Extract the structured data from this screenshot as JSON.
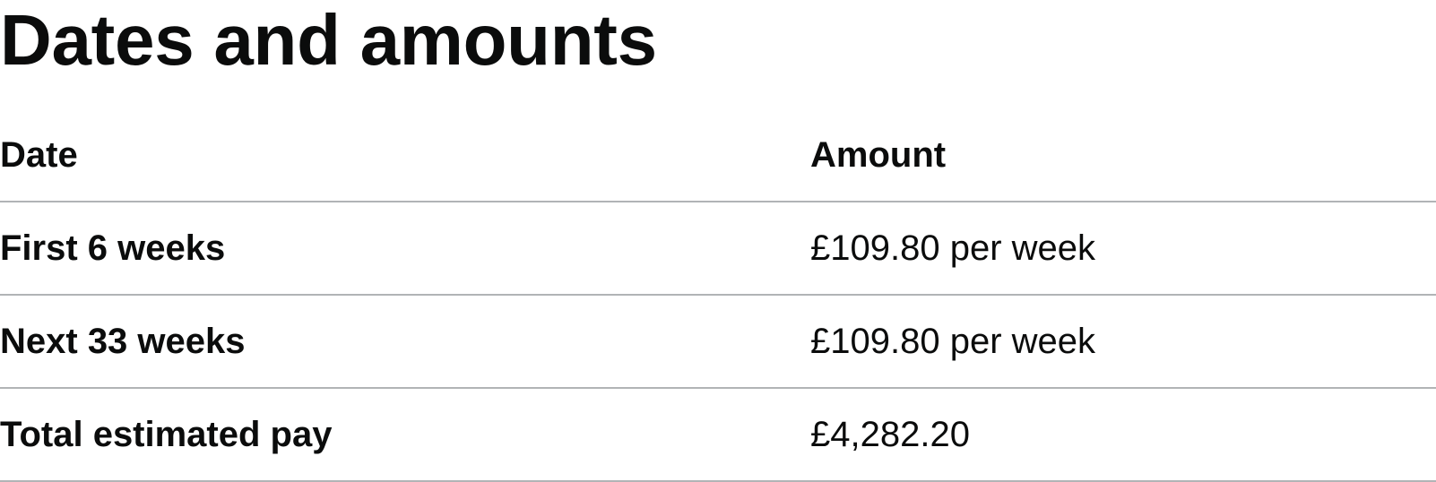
{
  "page": {
    "title": "Dates and amounts"
  },
  "table": {
    "headers": {
      "date": "Date",
      "amount": "Amount"
    },
    "rows": [
      {
        "date": "First 6 weeks",
        "amount": "£109.80 per week"
      },
      {
        "date": "Next 33 weeks",
        "amount": "£109.80 per week"
      },
      {
        "date": "Total estimated pay",
        "amount": "£4,282.20"
      }
    ]
  },
  "colors": {
    "text": "#0b0c0c",
    "border": "#b1b4b6",
    "background": "#ffffff"
  }
}
